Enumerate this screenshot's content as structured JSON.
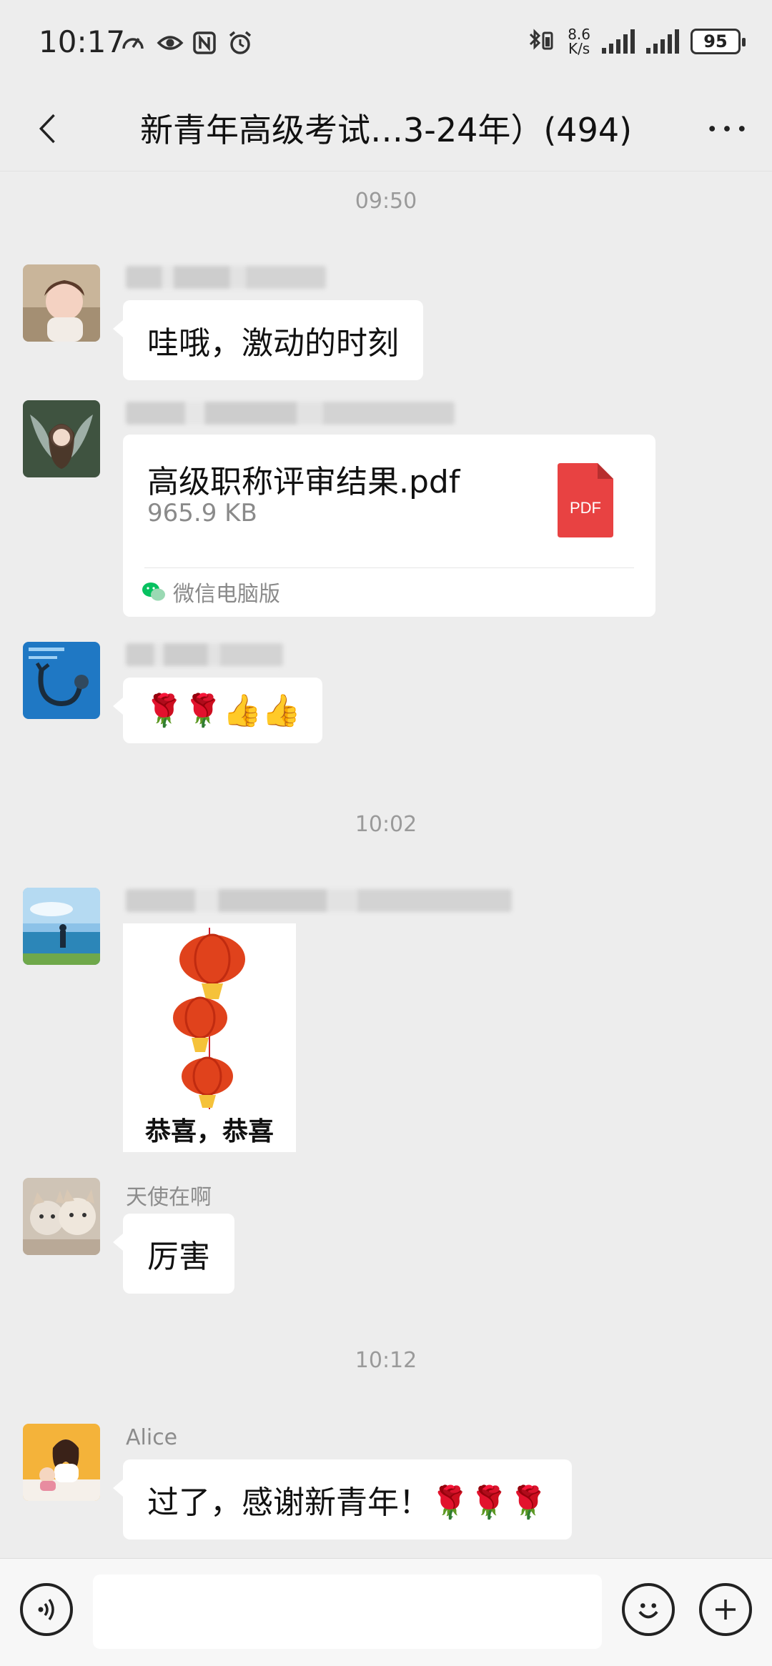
{
  "status_bar": {
    "time": "10:17",
    "net_speed_value": "8.6",
    "net_speed_unit": "K/s",
    "battery": "95"
  },
  "nav": {
    "title": "新青年高级考试…3-24年）(494)"
  },
  "messages": [
    {
      "type": "timestamp",
      "text": "09:50"
    },
    {
      "type": "text",
      "sender": "",
      "text": "哇哦，激动的时刻"
    },
    {
      "type": "file",
      "sender": "",
      "file_name": "高级职称评审结果.pdf",
      "file_size": "965.9 KB",
      "file_type_label": "PDF",
      "source": "微信电脑版"
    },
    {
      "type": "emoji",
      "sender": "",
      "text": "🌹🌹👍👍"
    },
    {
      "type": "timestamp",
      "text": "10:02"
    },
    {
      "type": "sticker",
      "sender": "",
      "caption": "恭喜，恭喜"
    },
    {
      "type": "text",
      "sender": "天使在啊",
      "text": "厉害"
    },
    {
      "type": "timestamp",
      "text": "10:12"
    },
    {
      "type": "text",
      "sender": "Alice",
      "text": "过了，感谢新青年！🌹🌹🌹"
    }
  ],
  "input_bar": {
    "placeholder": ""
  },
  "colors": {
    "background": "#ededed",
    "bubble": "#ffffff",
    "pdf_red": "#e84242",
    "wechat_green": "#07c160"
  }
}
